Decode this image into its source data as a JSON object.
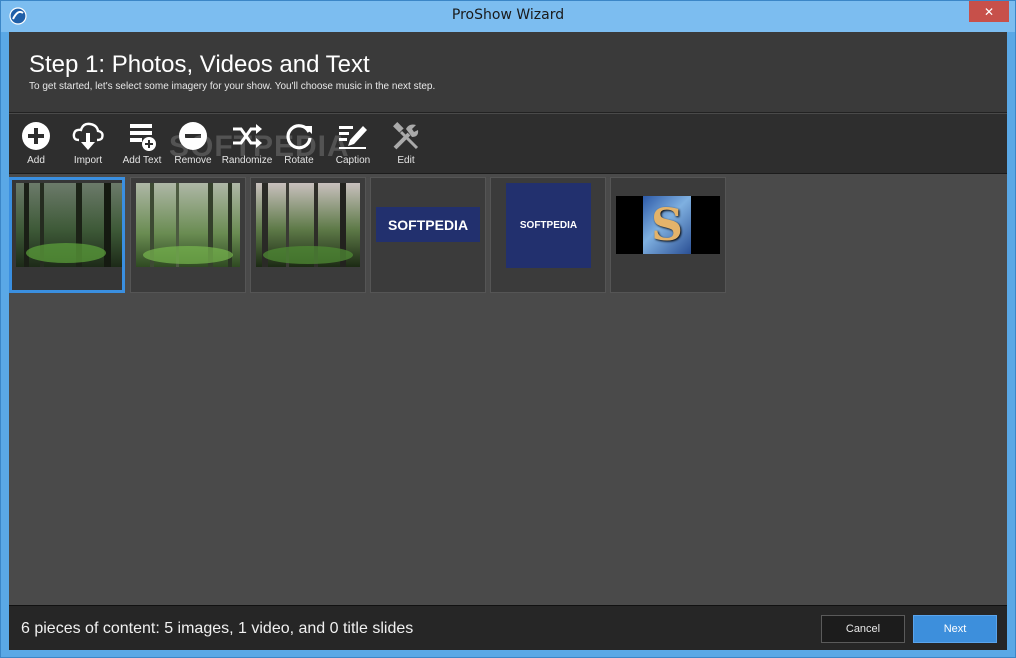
{
  "window": {
    "title": "ProShow Wizard",
    "close_glyph": "✕"
  },
  "header": {
    "title": "Step 1: Photos, Videos and Text",
    "subtitle": "To get started, let's select some imagery for your show. You'll choose music in the next step."
  },
  "toolbar": {
    "items": [
      {
        "label": "Add",
        "icon": "add-circle-icon"
      },
      {
        "label": "Import",
        "icon": "cloud-download-icon"
      },
      {
        "label": "Add Text",
        "icon": "add-text-icon"
      },
      {
        "label": "Remove",
        "icon": "remove-circle-icon"
      },
      {
        "label": "Randomize",
        "icon": "shuffle-icon"
      },
      {
        "label": "Rotate",
        "icon": "rotate-icon"
      },
      {
        "label": "Caption",
        "icon": "caption-pen-icon"
      },
      {
        "label": "Edit",
        "icon": "tools-icon"
      }
    ]
  },
  "watermark": "SOFTPEDIA",
  "thumbnails": [
    {
      "kind": "forest-photo",
      "selected": true
    },
    {
      "kind": "forest-photo",
      "selected": false
    },
    {
      "kind": "forest-photo",
      "selected": false
    },
    {
      "kind": "logo-banner",
      "text": "SOFTPEDIA",
      "selected": false
    },
    {
      "kind": "logo-square",
      "text": "SOFTPEDIA",
      "selected": false
    },
    {
      "kind": "video-logo",
      "text": "S",
      "selected": false
    }
  ],
  "footer": {
    "status": "6 pieces of content: 5 images, 1 video, and 0 title slides",
    "cancel_label": "Cancel",
    "next_label": "Next"
  },
  "colors": {
    "accent": "#3a8fe0",
    "logo_blue": "#22306e"
  }
}
